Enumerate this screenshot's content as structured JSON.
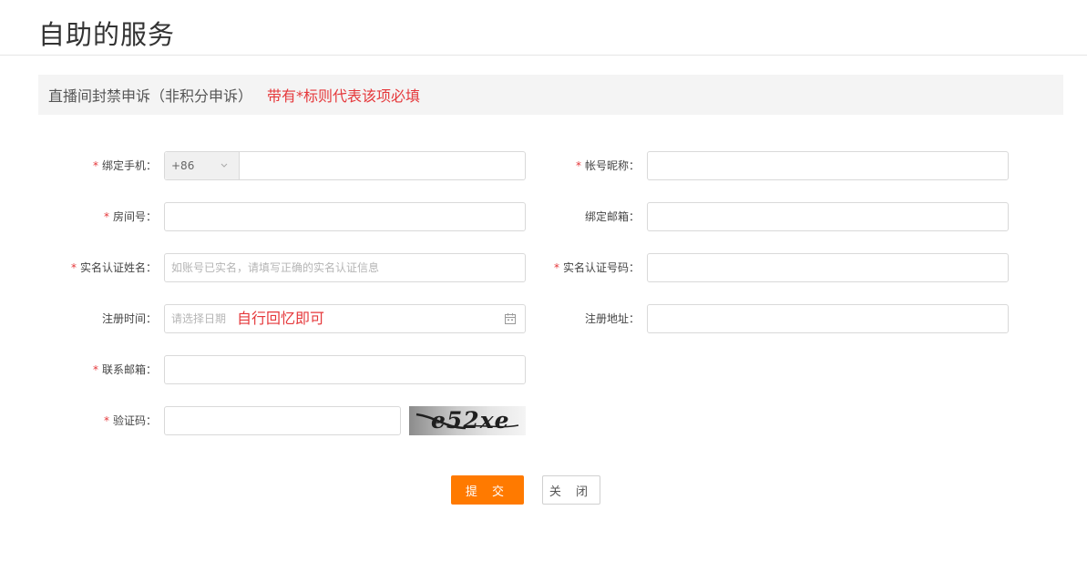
{
  "page": {
    "title": "自助的服务"
  },
  "banner": {
    "title": "直播间封禁申诉（非积分申诉）",
    "note": "带有*标则代表该项必填"
  },
  "form": {
    "required_mark": "*",
    "phone": {
      "label": "绑定手机：",
      "prefix": "+86",
      "value": ""
    },
    "nickname": {
      "label": "帐号昵称：",
      "value": ""
    },
    "room": {
      "label": "房间号：",
      "value": ""
    },
    "email_bind": {
      "label": "绑定邮箱：",
      "value": ""
    },
    "real_name": {
      "label": "实名认证姓名：",
      "placeholder": "如账号已实名，请填写正确的实名认证信息"
    },
    "id_number": {
      "label": "实名认证号码：",
      "value": ""
    },
    "reg_time": {
      "label": "注册时间：",
      "placeholder": "请选择日期",
      "hint": "自行回忆即可"
    },
    "reg_address": {
      "label": "注册地址：",
      "value": ""
    },
    "contact_email": {
      "label": "联系邮箱：",
      "value": ""
    },
    "captcha": {
      "label": "验证码：",
      "image_text": "e52xe"
    }
  },
  "buttons": {
    "submit": "提 交",
    "close": "关 闭"
  },
  "colors": {
    "accent": "#ff7a00",
    "required": "#e5383b",
    "banner_bg": "#f4f4f4"
  },
  "icons": [
    "chevron-down-icon",
    "calendar-icon"
  ]
}
